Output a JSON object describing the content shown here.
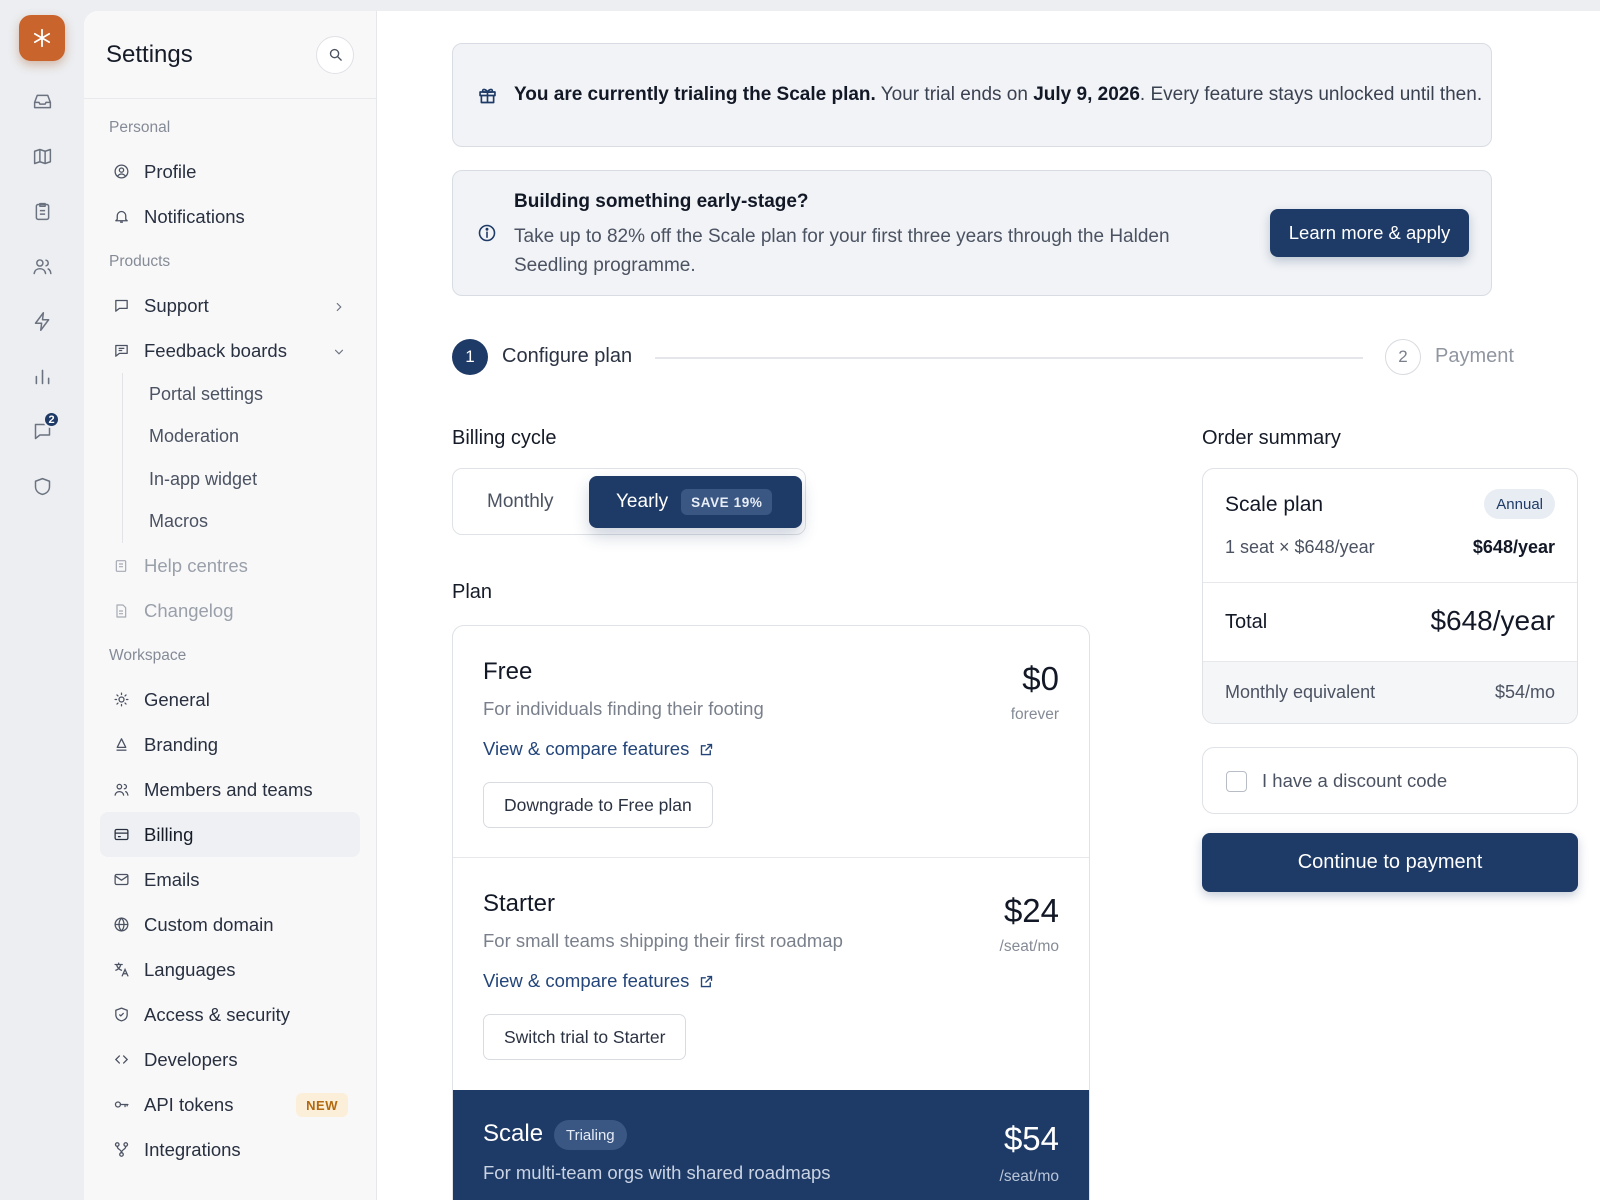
{
  "rail": {
    "notification_count": "2"
  },
  "sidebar": {
    "title": "Settings",
    "sections": {
      "personal": "Personal",
      "products": "Products",
      "workspace": "Workspace"
    },
    "items": {
      "profile": "Profile",
      "notifications": "Notifications",
      "support": "Support",
      "feedback_boards": "Feedback boards",
      "portal_settings": "Portal settings",
      "moderation": "Moderation",
      "in_app_widget": "In-app widget",
      "macros": "Macros",
      "help_centres": "Help centres",
      "changelog": "Changelog",
      "general": "General",
      "branding": "Branding",
      "members": "Members and teams",
      "billing": "Billing",
      "emails": "Emails",
      "custom_domain": "Custom domain",
      "languages": "Languages",
      "access_security": "Access & security",
      "developers": "Developers",
      "api_tokens": "API tokens",
      "api_tokens_badge": "NEW",
      "integrations": "Integrations"
    }
  },
  "trial_banner": {
    "bold": "You are currently trialing the Scale plan.",
    "text1": " Your trial ends on ",
    "date": "July 9, 2026",
    "text2": ". Every feature stays unlocked until then."
  },
  "promo_banner": {
    "title": "Building something early-stage?",
    "description": "Take up to 82% off the Scale plan for your first three years through the Halden Seedling programme.",
    "button": "Learn more & apply"
  },
  "stepper": {
    "step1_num": "1",
    "step1_label": "Configure plan",
    "step2_num": "2",
    "step2_label": "Payment"
  },
  "billing_cycle": {
    "label": "Billing cycle",
    "monthly": "Monthly",
    "yearly": "Yearly",
    "save_badge": "SAVE 19%"
  },
  "plan_label": "Plan",
  "plans": {
    "free": {
      "name": "Free",
      "description": "For individuals finding their footing",
      "link": "View & compare features",
      "price": "$0",
      "unit": "forever",
      "button": "Downgrade to Free plan"
    },
    "starter": {
      "name": "Starter",
      "description": "For small teams shipping their first roadmap",
      "link": "View & compare features",
      "price": "$24",
      "unit": "/seat/mo",
      "button": "Switch trial to Starter"
    },
    "scale": {
      "name": "Scale",
      "badge": "Trialing",
      "description": "For multi-team orgs with shared roadmaps",
      "price": "$54",
      "unit": "/seat/mo"
    }
  },
  "summary": {
    "label": "Order summary",
    "plan_name": "Scale plan",
    "period_badge": "Annual",
    "line_label": "1 seat × $648/year",
    "line_value": "$648/year",
    "total_label": "Total",
    "total_value": "$648/year",
    "monthly_label": "Monthly equivalent",
    "monthly_value": "$54/mo"
  },
  "discount": {
    "label": "I have a discount code"
  },
  "continue_button": "Continue to payment",
  "colors": {
    "accent": "#1e3a66",
    "brand": "#c8642c",
    "new_badge": "#fcefd9"
  }
}
